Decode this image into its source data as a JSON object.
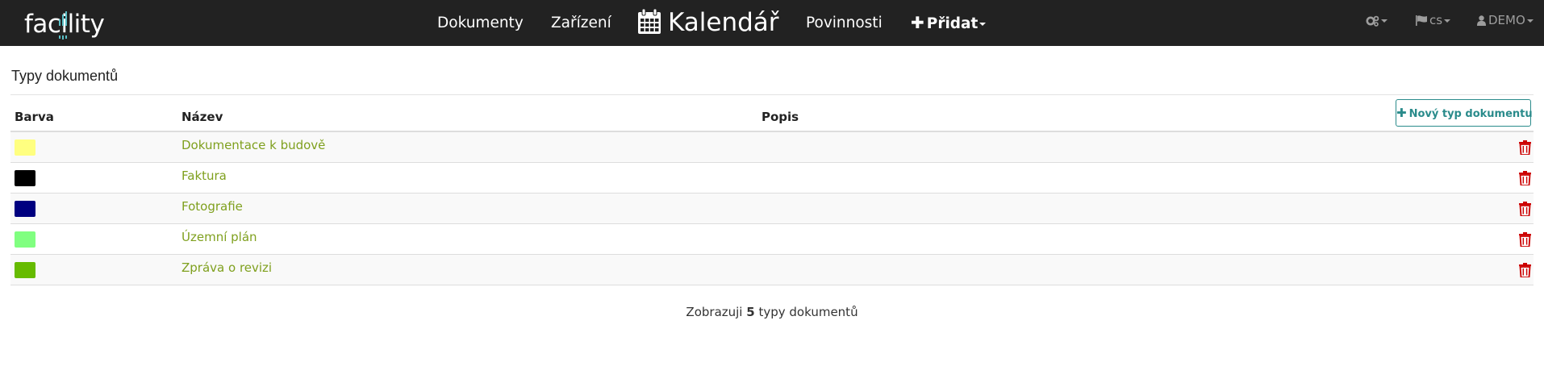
{
  "app": {
    "logo_text": "facility"
  },
  "nav": {
    "items": [
      {
        "label": "Dokumenty"
      },
      {
        "label": "Zařízení"
      },
      {
        "label": "Kalendář"
      },
      {
        "label": "Povinnosti"
      },
      {
        "label": "Přidat"
      }
    ],
    "lang": "cs",
    "user": "DEMO"
  },
  "page": {
    "title": "Typy dokumentů",
    "new_button_label": "Nový typ dokumentu"
  },
  "table": {
    "columns": [
      "Barva",
      "Název",
      "Popis"
    ],
    "rows": [
      {
        "name": "Dokumentace k budově",
        "color": "#ffff80",
        "description": ""
      },
      {
        "name": "Faktura",
        "color": "#000000",
        "description": ""
      },
      {
        "name": "Fotografie",
        "color": "#000080",
        "description": ""
      },
      {
        "name": "Územní plán",
        "color": "#80ff80",
        "description": ""
      },
      {
        "name": "Zpráva o revizi",
        "color": "#66bb00",
        "description": ""
      }
    ]
  },
  "footer": {
    "prefix": "Zobrazuji",
    "count": "5",
    "suffix": "typy dokumentů"
  },
  "colors": {
    "navbar_bg": "#222222",
    "link": "#7fa01e",
    "accent_button": "#2a8b8b",
    "delete": "#cc0000"
  },
  "icons": {
    "logo": "facility-logo-bars",
    "calendar": "calendar-icon",
    "plus": "plus-icon",
    "gears": "gears-icon",
    "flag": "flag-icon",
    "user": "user-icon",
    "trash": "trash-icon"
  }
}
